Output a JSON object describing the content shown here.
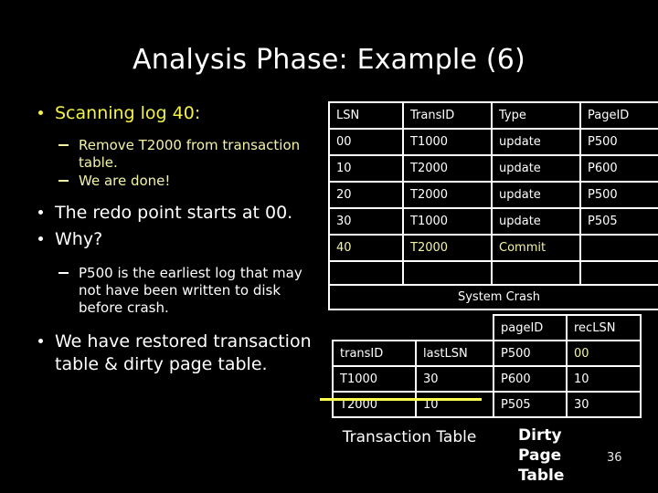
{
  "slide": {
    "title": "Analysis Phase: Example (6)",
    "page_number": "36",
    "background_color": "#000000",
    "accent_yellow": "#f2f24a",
    "accent_pale_yellow": "#f4f4a0",
    "strike_color": "#ffff4d"
  },
  "bullets": [
    {
      "level": 1,
      "color": "yellow",
      "text": "Scanning log 40:"
    },
    {
      "level": 2,
      "color": "pale-yellow",
      "text": "Remove T2000 from transaction table."
    },
    {
      "level": 2,
      "color": "pale-yellow",
      "text": "We are done!"
    },
    {
      "level": 1,
      "color": "white",
      "text": "The redo point starts at 00."
    },
    {
      "level": 1,
      "color": "white",
      "text": "Why?"
    },
    {
      "level": 2,
      "color": "white",
      "text": "P500 is the earliest log that may not have been written to disk before crash."
    },
    {
      "level": 1,
      "color": "white",
      "text": "We have restored transaction table & dirty page table."
    }
  ],
  "log_table": {
    "headers": [
      "LSN",
      "TransID",
      "Type",
      "PageID"
    ],
    "rows": [
      {
        "cells": [
          "00",
          "T1000",
          "update",
          "P500"
        ],
        "highlight": false
      },
      {
        "cells": [
          "10",
          "T2000",
          "update",
          "P600"
        ],
        "highlight": false
      },
      {
        "cells": [
          "20",
          "T2000",
          "update",
          "P500"
        ],
        "highlight": false
      },
      {
        "cells": [
          "30",
          "T1000",
          "update",
          "P505"
        ],
        "highlight": false
      },
      {
        "cells": [
          "40",
          "T2000",
          "Commit",
          ""
        ],
        "highlight": true
      },
      {
        "cells": [
          "",
          "",
          "",
          ""
        ],
        "highlight": false
      }
    ],
    "crash_label": "System Crash"
  },
  "transaction_table": {
    "caption": "Transaction Table",
    "headers": [
      "transID",
      "lastLSN"
    ],
    "rows": [
      {
        "cells": [
          "T1000",
          "30"
        ],
        "struck": false
      },
      {
        "cells": [
          "T2000",
          "10"
        ],
        "struck": true
      }
    ]
  },
  "dirty_page_table": {
    "caption": "Dirty Page Table",
    "headers": [
      "pageID",
      "recLSN"
    ],
    "rows": [
      {
        "cells": [
          "P500",
          "00"
        ],
        "accent_index": 1
      },
      {
        "cells": [
          "P600",
          "10"
        ],
        "accent_index": -1
      },
      {
        "cells": [
          "P505",
          "30"
        ],
        "accent_index": -1
      }
    ]
  }
}
